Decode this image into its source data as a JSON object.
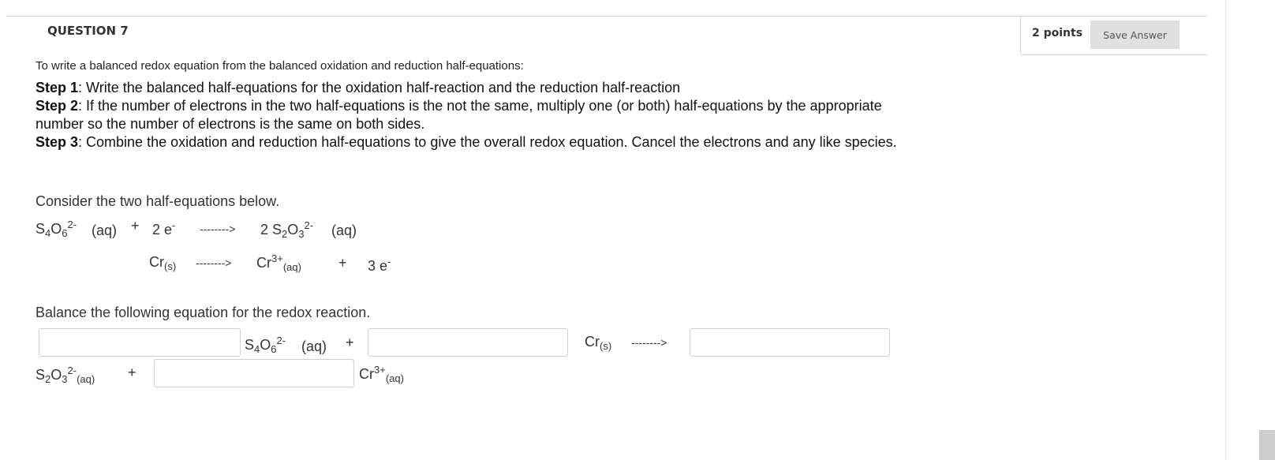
{
  "question": {
    "title": "QUESTION 7",
    "points": "2 points",
    "save_label": "Save Answer"
  },
  "intro": "To write a balanced redox equation from the balanced oxidation and reduction half-equations:",
  "steps": [
    {
      "label": "Step 1",
      "text": ": Write the balanced half-equations for the oxidation half-reaction and the reduction half-reaction"
    },
    {
      "label": "Step 2",
      "text": ": If the number of electrons in the two half-equations is the not the same, multiply one (or both) half-equations by the appropriate number so the number of electrons is the same on both sides."
    },
    {
      "label": "Step 3",
      "text": ": Combine the oxidation and reduction half-equations to give the overall redox equation. Cancel the electrons and any like species."
    }
  ],
  "consider": "Consider the two half-equations below.",
  "chem": {
    "s4o6": "S",
    "s4o6_n1": "4",
    "s4o6_o": "O",
    "s4o6_n2": "6",
    "s4o6_charge": "2-",
    "aq": "(aq)",
    "s": "(s)",
    "plus": "+",
    "two_e": "2 e",
    "three_e": "3 e",
    "minus": "-",
    "arrow": "-------->",
    "two_s2o3_coef": "2 ",
    "s2o3_s": "S",
    "s2o3_n1": "2",
    "s2o3_o": "O",
    "s2o3_n2": "3",
    "s2o3_charge": "2-",
    "cr": "Cr",
    "cr_charge": "3+"
  },
  "balance": "Balance the following equation for the redox reaction.",
  "inputs": {
    "coef_s4o6": "",
    "coef_cr": "",
    "coef_s2o3": "",
    "coef_cr3": ""
  }
}
